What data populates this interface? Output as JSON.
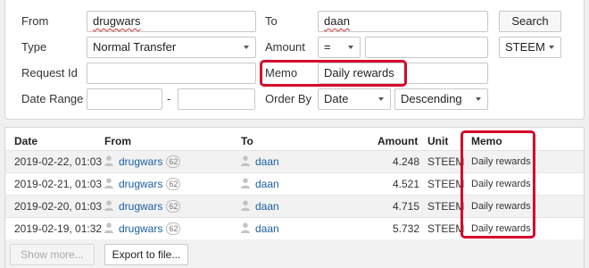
{
  "filters": {
    "from_label": "From",
    "from_value": "drugwars",
    "to_label": "To",
    "to_value": "daan",
    "search_label": "Search",
    "type_label": "Type",
    "type_value": "Normal Transfer",
    "amount_label": "Amount",
    "amount_op": "=",
    "amount_value": "",
    "currency_value": "STEEM",
    "request_id_label": "Request Id",
    "request_id_value": "",
    "memo_label": "Memo",
    "memo_value": "Daily rewards",
    "date_range_label": "Date Range",
    "date_from_value": "",
    "date_separator": "-",
    "date_to_value": "",
    "order_by_label": "Order By",
    "order_by_value": "Date",
    "order_dir_value": "Descending"
  },
  "table": {
    "headers": {
      "date": "Date",
      "from": "From",
      "to": "To",
      "amount": "Amount",
      "unit": "Unit",
      "memo": "Memo"
    },
    "rows": [
      {
        "date": "2019-02-22, 01:03",
        "from": "drugwars",
        "from_rep": "62",
        "to": "daan",
        "amount": "4.248",
        "unit": "STEEM",
        "memo": "Daily rewards"
      },
      {
        "date": "2019-02-21, 01:03",
        "from": "drugwars",
        "from_rep": "62",
        "to": "daan",
        "amount": "4.521",
        "unit": "STEEM",
        "memo": "Daily rewards"
      },
      {
        "date": "2019-02-20, 01:03",
        "from": "drugwars",
        "from_rep": "62",
        "to": "daan",
        "amount": "4.715",
        "unit": "STEEM",
        "memo": "Daily rewards"
      },
      {
        "date": "2019-02-19, 01:32",
        "from": "drugwars",
        "from_rep": "62",
        "to": "daan",
        "amount": "5.732",
        "unit": "STEEM",
        "memo": "Daily rewards"
      }
    ]
  },
  "footer": {
    "show_more_label": "Show more...",
    "export_label": "Export to file..."
  },
  "colors": {
    "highlight": "#d6082b",
    "link": "#1a5fa3"
  }
}
